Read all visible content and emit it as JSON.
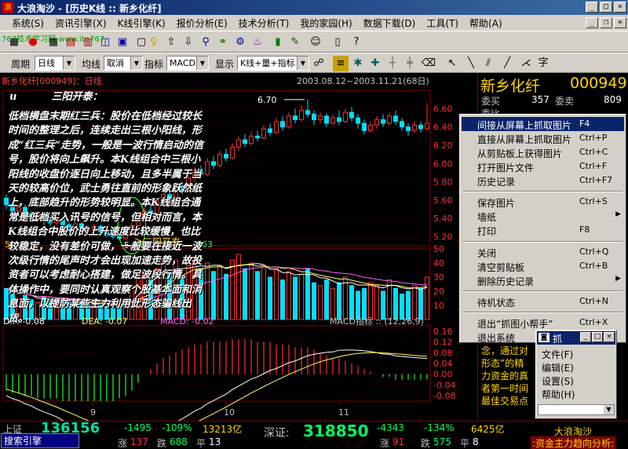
{
  "window": {
    "title": "大浪淘沙 - [历史K线 :: 新乡化纤]",
    "app_icon": "浪",
    "min": "_",
    "max": "□",
    "close": "×",
    "restore": "❐"
  },
  "menubar": {
    "items": [
      "系统(S)",
      "资讯引擎(X)",
      "K线引擎(K)",
      "报价分析(E)",
      "技术分析(T)",
      "我的家园(H)",
      "数据下载(D)",
      "工具(T)",
      "帮助(A)"
    ]
  },
  "toolbar1": {
    "watermark": "767技术学习网 www.itp767"
  },
  "toolbar2": {
    "period_label": "周期",
    "period_value": "日线",
    "ma_label": "均线",
    "ma_value": "取消",
    "indicator_label": "指标",
    "indicator_value": "MACD",
    "display_label": "显示",
    "display_value": "K线+量+指标",
    "font_char": "字"
  },
  "chart": {
    "title": "新乡化纤[000949]：日线",
    "range": "2003.08.12~2003.11.21(68日)",
    "high_label": "6.70",
    "low_label": "5.16",
    "annotation": "三阳开泰",
    "right_axis": [
      "6.60",
      "6.40",
      "6.20",
      "6.00",
      "5.80",
      "5.60",
      "5.40",
      "5.20"
    ],
    "vol_axis": [
      "50",
      "40",
      "30",
      "20",
      "10"
    ],
    "macd_axis": [
      "0.16",
      "0.12",
      "0.08",
      "0.04",
      "0.00",
      "-0.04",
      "-0.08"
    ],
    "vol_readout": "5",
    "vol_163": "163",
    "macd_readout": {
      "dif": "DIF: -0.08",
      "dea": "DEA: -0.07",
      "macd": "MACD: -0.02",
      "name": "MACD指标 :: (12,26,9)"
    },
    "x_labels": [
      "9",
      "10",
      "11"
    ]
  },
  "chart_data": {
    "type": "candlestick",
    "ylim": [
      5.1,
      6.75
    ],
    "candles": [
      [
        5.62,
        5.55,
        5.66,
        5.5
      ],
      [
        5.55,
        5.48,
        5.58,
        5.44
      ],
      [
        5.48,
        5.52,
        5.56,
        5.45
      ],
      [
        5.52,
        5.45,
        5.55,
        5.4
      ],
      [
        5.45,
        5.4,
        5.48,
        5.36
      ],
      [
        5.4,
        5.44,
        5.47,
        5.37
      ],
      [
        5.44,
        5.38,
        5.46,
        5.33
      ],
      [
        5.38,
        5.35,
        5.41,
        5.31
      ],
      [
        5.35,
        5.39,
        5.42,
        5.32
      ],
      [
        5.39,
        5.33,
        5.41,
        5.29
      ],
      [
        5.33,
        5.3,
        5.36,
        5.26
      ],
      [
        5.3,
        5.34,
        5.37,
        5.27
      ],
      [
        5.34,
        5.29,
        5.36,
        5.25
      ],
      [
        5.29,
        5.27,
        5.32,
        5.22
      ],
      [
        5.27,
        5.31,
        5.34,
        5.24
      ],
      [
        5.31,
        5.25,
        5.33,
        5.21
      ],
      [
        5.25,
        5.22,
        5.28,
        5.19
      ],
      [
        5.22,
        5.2,
        5.25,
        5.17
      ],
      [
        5.2,
        5.18,
        5.23,
        5.16
      ],
      [
        5.18,
        5.24,
        5.27,
        5.17
      ],
      [
        5.24,
        5.32,
        5.35,
        5.23
      ],
      [
        5.32,
        5.4,
        5.43,
        5.3
      ],
      [
        5.4,
        5.48,
        5.52,
        5.38
      ],
      [
        5.48,
        5.45,
        5.55,
        5.42
      ],
      [
        5.45,
        5.58,
        5.62,
        5.44
      ],
      [
        5.58,
        5.66,
        5.7,
        5.55
      ],
      [
        5.66,
        5.62,
        5.72,
        5.58
      ],
      [
        5.62,
        5.75,
        5.79,
        5.6
      ],
      [
        5.75,
        5.7,
        5.8,
        5.66
      ],
      [
        5.7,
        5.84,
        5.88,
        5.68
      ],
      [
        5.84,
        5.92,
        5.96,
        5.8
      ],
      [
        5.92,
        5.88,
        5.98,
        5.84
      ],
      [
        5.88,
        6.02,
        6.06,
        5.86
      ],
      [
        6.02,
        5.98,
        6.08,
        5.94
      ],
      [
        5.98,
        6.1,
        6.14,
        5.95
      ],
      [
        6.1,
        6.06,
        6.16,
        6.02
      ],
      [
        6.06,
        6.18,
        6.22,
        6.04
      ],
      [
        6.18,
        6.26,
        6.3,
        6.14
      ],
      [
        6.26,
        6.22,
        6.32,
        6.18
      ],
      [
        6.22,
        6.3,
        6.35,
        6.2
      ],
      [
        6.3,
        6.28,
        6.36,
        6.24
      ],
      [
        6.28,
        6.38,
        6.42,
        6.26
      ],
      [
        6.38,
        6.34,
        6.44,
        6.3
      ],
      [
        6.34,
        6.46,
        6.5,
        6.32
      ],
      [
        6.46,
        6.4,
        6.52,
        6.36
      ],
      [
        6.4,
        6.52,
        6.56,
        6.38
      ],
      [
        6.52,
        6.48,
        6.6,
        6.44
      ],
      [
        6.48,
        6.58,
        6.64,
        6.46
      ],
      [
        6.58,
        6.54,
        6.7,
        6.5
      ],
      [
        6.54,
        6.48,
        6.58,
        6.42
      ],
      [
        6.48,
        6.52,
        6.56,
        6.44
      ],
      [
        6.52,
        6.44,
        6.55,
        6.4
      ],
      [
        6.44,
        6.5,
        6.54,
        6.42
      ],
      [
        6.5,
        6.46,
        6.58,
        6.42
      ],
      [
        6.46,
        6.56,
        6.6,
        6.44
      ],
      [
        6.56,
        6.5,
        6.62,
        6.46
      ],
      [
        6.5,
        6.44,
        6.54,
        6.38
      ],
      [
        6.44,
        6.36,
        6.48,
        6.32
      ],
      [
        6.36,
        6.42,
        6.46,
        6.34
      ],
      [
        6.42,
        6.48,
        6.52,
        6.38
      ],
      [
        6.48,
        6.44,
        6.54,
        6.4
      ],
      [
        6.44,
        6.52,
        6.56,
        6.42
      ],
      [
        6.52,
        6.46,
        6.58,
        6.42
      ],
      [
        6.46,
        6.4,
        6.5,
        6.36
      ],
      [
        6.4,
        6.36,
        6.44,
        6.3
      ],
      [
        6.36,
        6.42,
        6.46,
        6.34
      ],
      [
        6.42,
        6.38,
        6.46,
        6.34
      ],
      [
        6.38,
        6.44,
        6.66,
        6.36
      ]
    ],
    "volume": [
      22,
      18,
      15,
      17,
      14,
      12,
      16,
      13,
      11,
      14,
      12,
      10,
      13,
      11,
      12,
      10,
      9,
      8,
      9,
      14,
      24,
      30,
      34,
      28,
      36,
      40,
      32,
      42,
      30,
      38,
      44,
      36,
      40,
      34,
      38,
      32,
      42,
      46,
      36,
      40,
      34,
      38,
      30,
      36,
      28,
      34,
      30,
      32,
      36,
      26,
      24,
      28,
      22,
      26,
      30,
      24,
      20,
      22,
      26,
      24,
      20,
      28,
      22,
      18,
      20,
      24,
      22,
      30
    ],
    "macd_hist": [
      -0.06,
      -0.07,
      -0.07,
      -0.08,
      -0.08,
      -0.09,
      -0.09,
      -0.09,
      -0.09,
      -0.1,
      -0.1,
      -0.1,
      -0.1,
      -0.1,
      -0.1,
      -0.1,
      -0.1,
      -0.1,
      -0.09,
      -0.08,
      -0.06,
      -0.03,
      0.0,
      0.02,
      0.04,
      0.06,
      0.07,
      0.08,
      0.09,
      0.1,
      0.11,
      0.11,
      0.12,
      0.12,
      0.12,
      0.12,
      0.13,
      0.13,
      0.13,
      0.13,
      0.12,
      0.12,
      0.12,
      0.11,
      0.11,
      0.11,
      0.1,
      0.1,
      0.1,
      0.09,
      0.08,
      0.07,
      0.06,
      0.06,
      0.05,
      0.04,
      0.03,
      0.02,
      0.01,
      0.0,
      -0.01,
      -0.01,
      -0.02,
      -0.02,
      -0.02,
      -0.02,
      -0.02,
      -0.02
    ]
  },
  "article": {
    "bullet": "u",
    "heading": "三阳开泰：",
    "body": "低档横盘末期红三兵：股价在低档经过较长时间的整理之后，连续走出三根小阳线，形成“红三兵”走势，一般是一波行情启动的信号，股价将向上飙升。本K线组合中三根小阳线的收盘价逐日向上移动，且多半属于当天的较高价位，武士勇往直前的形象跃然纸上，底部趋升的形势较明显。本K线组合通常是低档买入讯号的信号，但相对而言，本K线组合中股价的上升速度比较缓慢，也比较稳定，没有差价可做，一般要在接近一波次级行情的尾声时才会出现加速走势，故投资者可以考虑耐心搭建，做足波段行情。具体操作中，要同时认真观察个股基本面和消息面，以提防某些主力利用此形态骗线出货。"
  },
  "right_panel": {
    "name": "新乡化纤",
    "code": "000949",
    "buy_label": "委买",
    "buy_value": "357",
    "sell_label": "委卖",
    "sell_value": "809",
    "ratio_label": "委比",
    "partial_text": "念，通过对\n形态”的精\n力资金的真\n者第一时间\n最佳交易点",
    "side_labels": [
      "开",
      "最",
      "最",
      "成",
      "成",
      "成",
      "涨",
      "换"
    ],
    "mid_label": "200"
  },
  "context_menu": {
    "items": [
      {
        "label": "间接从屏幕上抓取图片",
        "shortcut": "F4"
      },
      {
        "label": "直接从屏幕上抓取图片",
        "shortcut": "Ctrl+P"
      },
      {
        "label": "从剪贴板上获得图片",
        "shortcut": "Ctrl+C"
      },
      {
        "label": "打开图片文件",
        "shortcut": "Ctrl+F"
      },
      {
        "label": "历史记录",
        "shortcut": "Ctrl+F7"
      },
      {
        "label": "保存图片",
        "shortcut": "Ctrl+S"
      },
      {
        "label": "墙纸",
        "shortcut": ""
      },
      {
        "label": "打印",
        "shortcut": "F8"
      },
      {
        "label": "关闭",
        "shortcut": "Ctrl+Q"
      },
      {
        "label": "清空剪贴板",
        "shortcut": "Ctrl+B"
      },
      {
        "label": "删除历史记录",
        "shortcut": ""
      },
      {
        "label": "待机状态",
        "shortcut": "Ctrl+N"
      },
      {
        "label": "退出“抓图小帮手”",
        "shortcut": "Ctrl+X"
      },
      {
        "label": "退出系统",
        "shortcut": ""
      }
    ]
  },
  "mini_window": {
    "title": "抓",
    "items": [
      "文件(F)",
      "编辑(E)",
      "设置(S)",
      "帮助(H)"
    ]
  },
  "statusbar": {
    "search": "搜索引擎",
    "sh_label": "上证",
    "sh_value": "136156",
    "sh_change": "-1495",
    "sh_pct": "-109%",
    "sh_vol": "13213亿",
    "sh_up_label": "涨",
    "sh_up": "137",
    "sh_down_label": "跌",
    "sh_down": "688",
    "sh_flat_label": "平",
    "sh_flat": "13",
    "sz_label": "深证:",
    "sz_value": "318850",
    "sz_change": "-4343",
    "sz_pct": "-134%",
    "sz_vol": "6425亿",
    "sz_up_label": "涨",
    "sz_up": "91",
    "sz_down_label": "跌",
    "sz_down": "575",
    "sz_flat_label": "平",
    "sz_flat": "8",
    "brand": "大浪淘沙",
    "ticker": ":资金主力趋向分析:"
  },
  "colors": {
    "up": "#ff3030",
    "down": "#00e0ff",
    "macd_yellow": "#ffff60",
    "macd_white": "#ffffff",
    "accent_gold": "#ffd700"
  }
}
